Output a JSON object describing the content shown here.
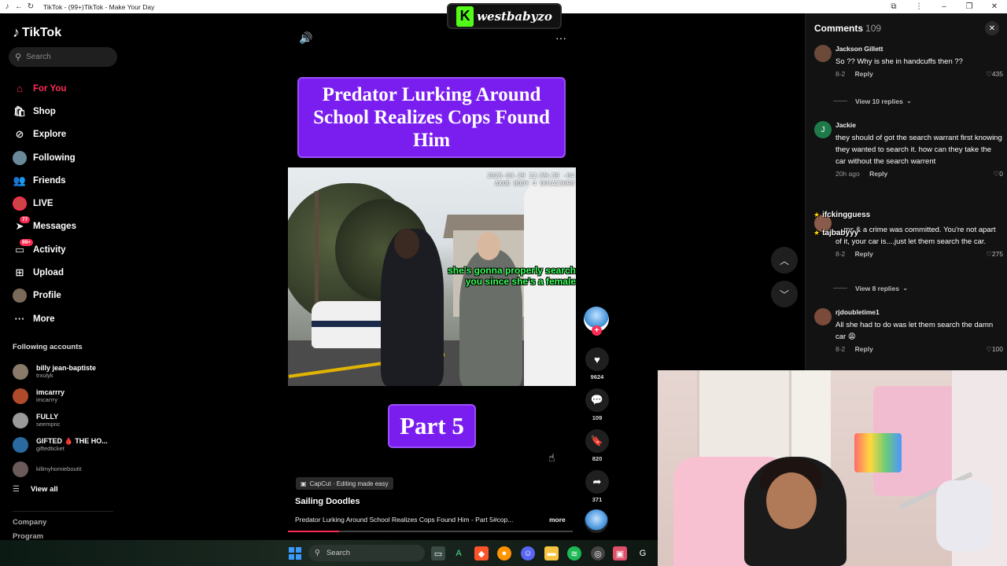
{
  "browser": {
    "tab_title": "TikTok - (99+)TikTok - Make Your Day"
  },
  "sidebar": {
    "logo_text": "TikTok",
    "search_placeholder": "Search",
    "nav": [
      {
        "label": "For You",
        "icon": "home-icon",
        "active": true
      },
      {
        "label": "Shop",
        "icon": "shop-bag-icon"
      },
      {
        "label": "Explore",
        "icon": "compass-icon"
      },
      {
        "label": "Following",
        "icon": "avatar-icon"
      },
      {
        "label": "Friends",
        "icon": "friends-icon"
      },
      {
        "label": "LIVE",
        "icon": "live-icon"
      },
      {
        "label": "Messages",
        "icon": "paper-plane-icon",
        "badge": "77"
      },
      {
        "label": "Activity",
        "icon": "inbox-icon",
        "badge": "99+"
      },
      {
        "label": "Upload",
        "icon": "plus-square-icon"
      },
      {
        "label": "Profile",
        "icon": "profile-avatar-icon"
      },
      {
        "label": "More",
        "icon": "ellipsis-icon"
      }
    ],
    "following_title": "Following accounts",
    "following": [
      {
        "name": "billy jean-baptiste",
        "handle": "trxulyk"
      },
      {
        "name": "imcarrry",
        "handle": "imcarrry"
      },
      {
        "name": "FULLY",
        "handle": "seempnc"
      },
      {
        "name": "GIFTED 🩸 THE HO...",
        "handle": "giftedticket"
      },
      {
        "name": "",
        "handle": "killmyhomieboutit"
      }
    ],
    "view_all": "View all",
    "footer": [
      "Company",
      "Program"
    ]
  },
  "watermark": {
    "logo_letter": "K",
    "name": "westbabyzo"
  },
  "video": {
    "title_overlay": "Predator Lurking Around School Realizes Cops Found Him",
    "bodycam_timestamp": "2025-03-29 12:59:39 -04",
    "bodycam_device": "AXON BODY 4 D01A23698",
    "caption": "she's gonna properly search you since she's a female",
    "part_label": "Part 5",
    "capcut_tag": "CapCut · Editing made easy",
    "author": "Sailing Doodles",
    "description": "Predator Lurking Around School Realizes Cops Found Him - Part 5#cop...",
    "more_label": "more",
    "progress_fraction": 0.18
  },
  "actions": {
    "likes": "9624",
    "comments": "109",
    "saves": "820",
    "shares": "371"
  },
  "comments_panel": {
    "title": "Comments",
    "count": "109",
    "items": [
      {
        "name": "Jackson Gillett",
        "text": "So ?? Why is she in handcuffs then ??",
        "date": "8-2",
        "reply": "Reply",
        "likes": "435",
        "avatar_color": "#6b4a3a"
      },
      {
        "name": "Jackie",
        "text": "they should of got the search warrant first knowing they wanted to search it. how can they take the car without the search warrent",
        "date": "20h ago",
        "reply": "Reply",
        "likes": "0",
        "avatar_color": "#1f7a4a",
        "avatar_letter": "J"
      },
      {
        "name": "",
        "text": "... ms & a crime was committed. You're not apart of it, your car is....just let them search the car.",
        "date": "8-2",
        "reply": "Reply",
        "likes": "275",
        "avatar_color": "#8a5a4a"
      },
      {
        "name": "rjdoubletime1",
        "text": "All she had to do was let them search the damn car 😩",
        "date": "8-2",
        "reply": "Reply",
        "likes": "100",
        "avatar_color": "#7a4a3a"
      }
    ],
    "view_replies_1": "View 10 replies",
    "view_replies_2": "View 8 replies"
  },
  "chat_overlay": {
    "line1": "ifckingguess",
    "line2": "tajbabyyy"
  },
  "taskbar": {
    "search_label": "Search"
  },
  "colors": {
    "accent": "#fe2c55",
    "title_box": "#7a1ef0",
    "kick_green": "#53fc18",
    "caption_green": "#38ff5a"
  }
}
